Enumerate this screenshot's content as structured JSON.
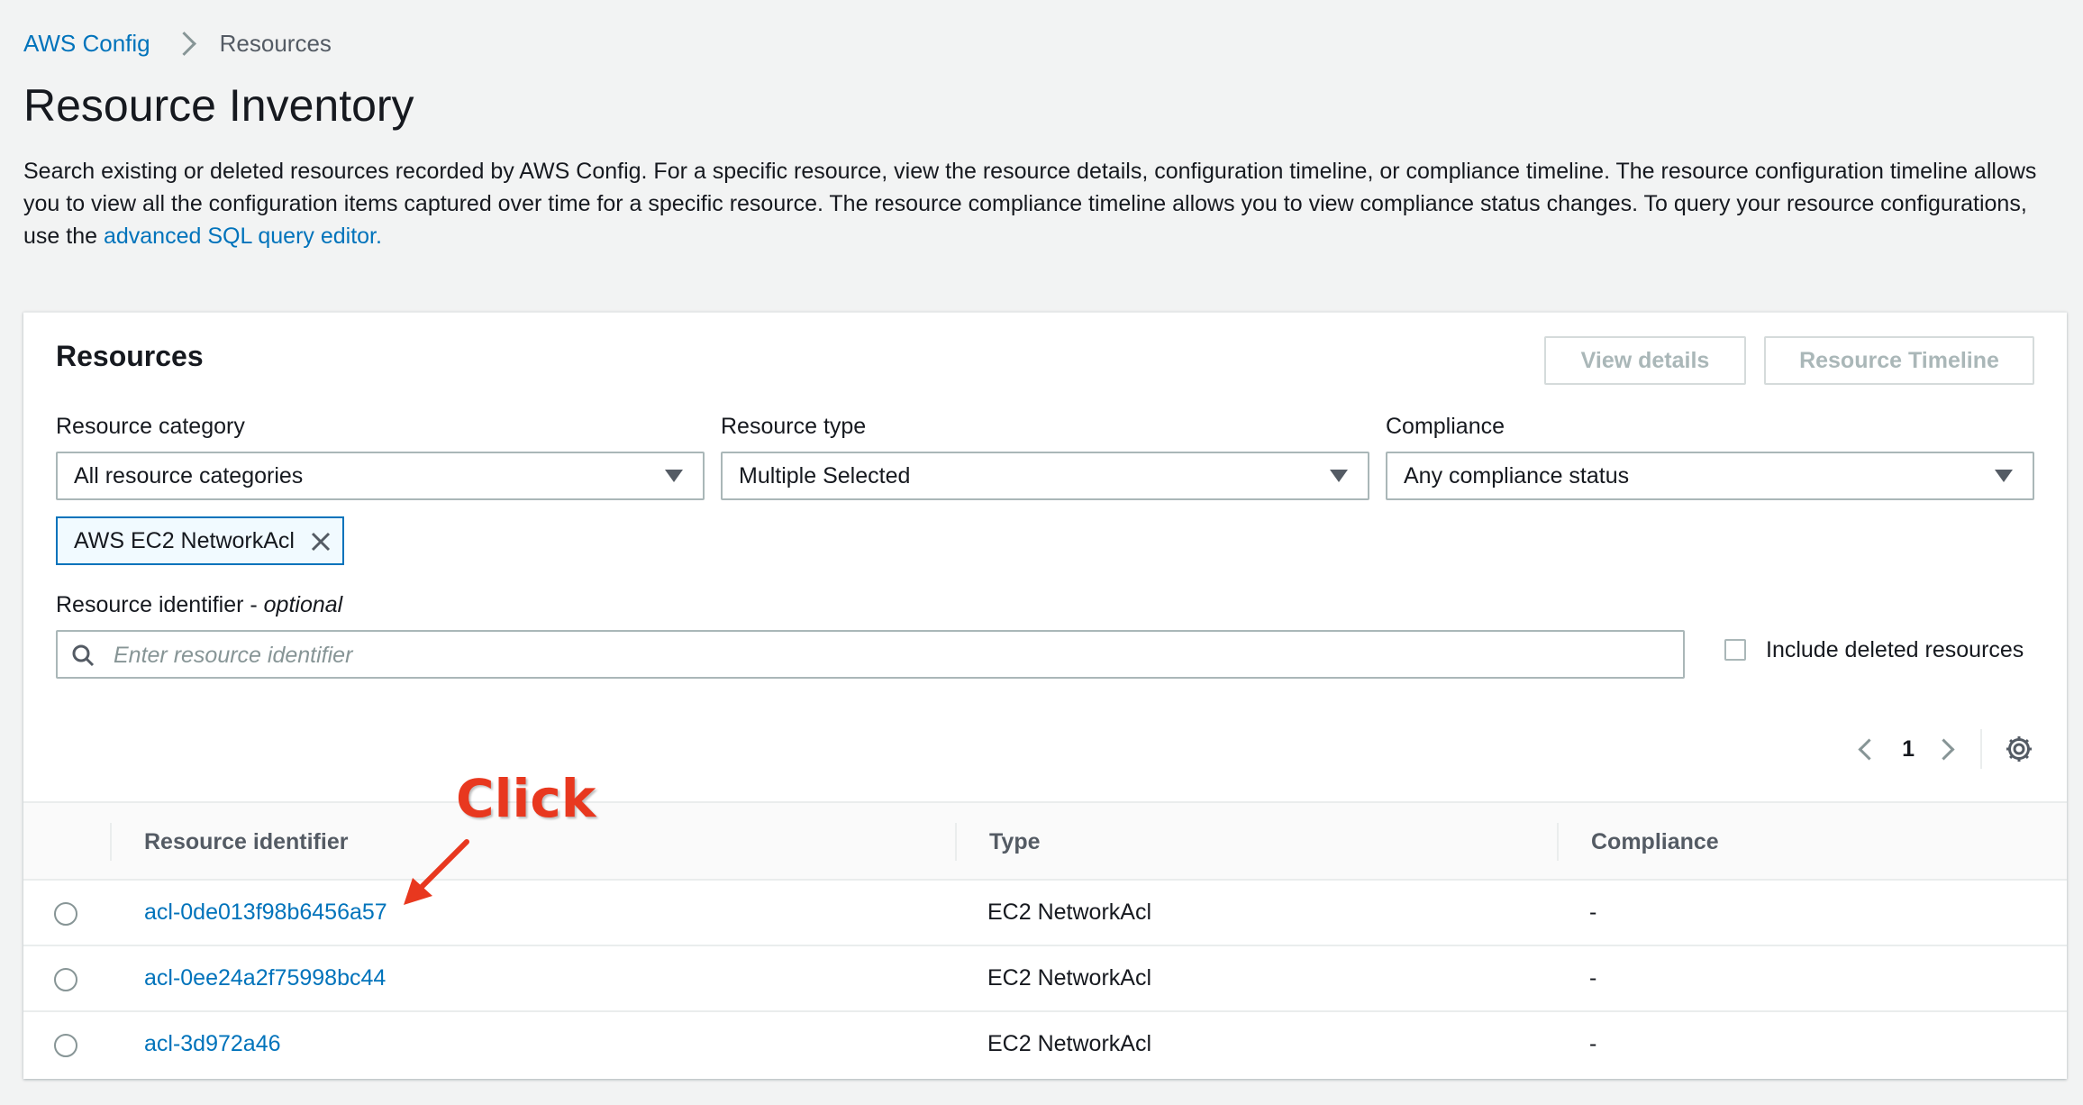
{
  "breadcrumb": {
    "root": "AWS Config",
    "current": "Resources"
  },
  "page": {
    "title": "Resource Inventory",
    "description_before_link": "Search existing or deleted resources recorded by AWS Config. For a specific resource, view the resource details, configuration timeline, or compliance timeline. The resource configuration timeline allows you to view all the configuration items captured over time for a specific resource. The resource compliance timeline allows you to view compliance status changes. To query your resource configurations, use the ",
    "description_link": "advanced SQL query editor."
  },
  "resources": {
    "title": "Resources",
    "buttons": {
      "view_details": "View details",
      "resource_timeline": "Resource Timeline"
    },
    "filters": {
      "category_label": "Resource category",
      "category_value": "All resource categories",
      "type_label": "Resource type",
      "type_value": "Multiple Selected",
      "compliance_label": "Compliance",
      "compliance_value": "Any compliance status"
    },
    "token": "AWS EC2 NetworkAcl",
    "identifier_label": "Resource identifier",
    "identifier_optional": "optional",
    "identifier_label_sep": " - ",
    "identifier_placeholder": "Enter resource identifier",
    "include_deleted": "Include deleted resources",
    "pagination": {
      "current_page": "1"
    },
    "table": {
      "headers": {
        "identifier": "Resource identifier",
        "type": "Type",
        "compliance": "Compliance"
      },
      "rows": [
        {
          "id": "acl-0de013f98b6456a57",
          "type": "EC2 NetworkAcl",
          "compliance": "-"
        },
        {
          "id": "acl-0ee24a2f75998bc44",
          "type": "EC2 NetworkAcl",
          "compliance": "-"
        },
        {
          "id": "acl-3d972a46",
          "type": "EC2 NetworkAcl",
          "compliance": "-"
        }
      ]
    }
  },
  "annotation": {
    "text": "Click"
  },
  "colors": {
    "link": "#0073bb",
    "annotation": "#e8381f",
    "background": "#f2f3f3"
  }
}
